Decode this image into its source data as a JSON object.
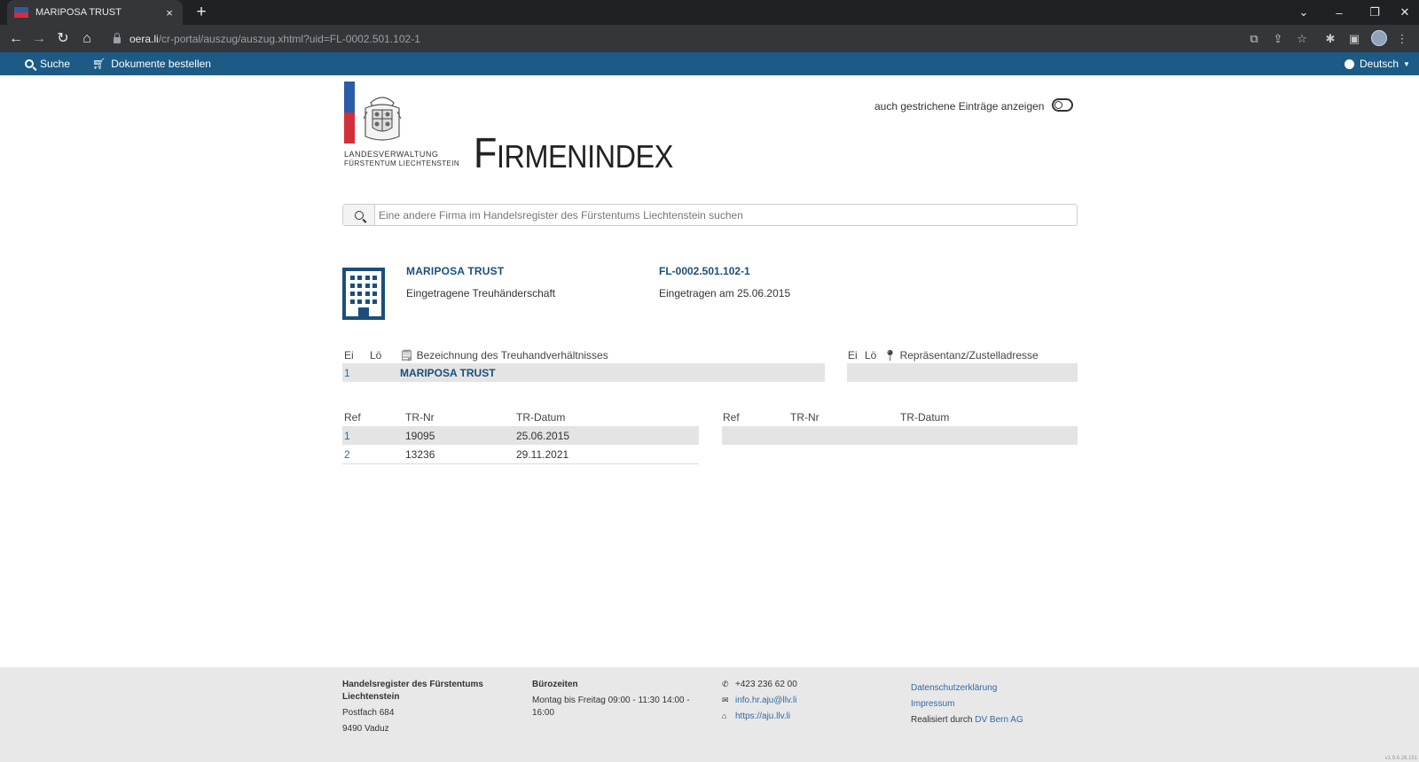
{
  "browser": {
    "tab_title": "MARIPOSA TRUST",
    "tab_close": "×",
    "new_tab": "+",
    "url_host": "oera.li",
    "url_path": "/cr-portal/auszug/auszug.xhtml?uid=FL-0002.501.102-1"
  },
  "appbar": {
    "search_label": "Suche",
    "order_label": "Dokumente bestellen",
    "language_label": "Deutsch"
  },
  "header": {
    "logo_line1": "LANDESVERWALTUNG",
    "logo_line2": "FÜRSTENTUM LIECHTENSTEIN",
    "title_first": "F",
    "title_rest": "IRMENINDEX",
    "toggle_label": "auch gestrichene Einträge anzeigen"
  },
  "search": {
    "placeholder": "Eine andere Firma im Handelsregister des Fürstentums Liechtenstein suchen"
  },
  "company": {
    "name": "MARIPOSA TRUST",
    "type": "Eingetragene Treuhänderschaft",
    "id": "FL-0002.501.102-1",
    "registered": "Eingetragen am 25.06.2015"
  },
  "names_table": {
    "headers": [
      "Ei",
      "Lö",
      "Bezeichnung des Treuhandverhältnisses"
    ],
    "rows": [
      {
        "ei": "1",
        "lo": "",
        "name": "MARIPOSA TRUST"
      }
    ]
  },
  "address_table": {
    "headers": [
      "Ei",
      "Lö",
      "Repräsentanz/Zustelladresse"
    ]
  },
  "tr_table_left": {
    "headers": [
      "Ref",
      "TR-Nr",
      "TR-Datum"
    ],
    "rows": [
      {
        "ref": "1",
        "nr": "19095",
        "date": "25.06.2015"
      },
      {
        "ref": "2",
        "nr": "13236",
        "date": "29.11.2021"
      }
    ]
  },
  "tr_table_right": {
    "headers": [
      "Ref",
      "TR-Nr",
      "TR-Datum"
    ]
  },
  "footer": {
    "org_line1": "Handelsregister des Fürstentums",
    "org_line2": "Liechtenstein",
    "postfach": "Postfach 684",
    "city": "9490 Vaduz",
    "hours_title": "Bürozeiten",
    "hours_line1": "Montag bis Freitag 09:00 - 11:30 14:00 -",
    "hours_line2": "16:00",
    "phone": "+423 236 62 00",
    "email": "info.hr.aju@llv.li",
    "web": "https://aju.llv.li",
    "privacy": "Datenschutzerklärung",
    "impressum": "Impressum",
    "realized_prefix": "Realisiert durch",
    "realized_by": "DV Bern AG",
    "version": "v1.9.6.26.151"
  }
}
